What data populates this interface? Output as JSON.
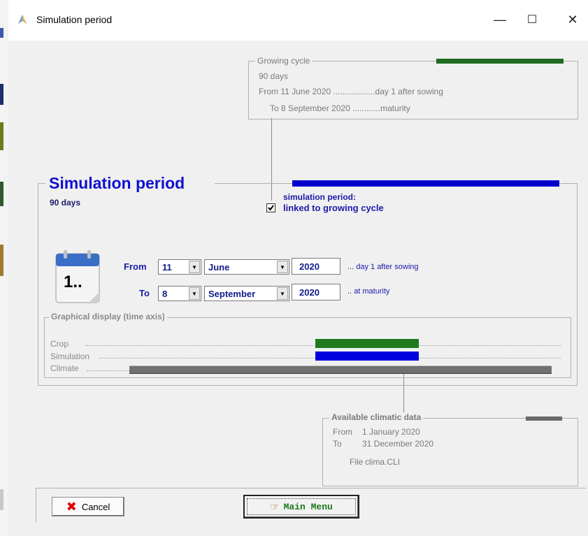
{
  "window": {
    "title": "Simulation period",
    "minimize": "—",
    "maximize": "☐",
    "close": "✕"
  },
  "growing_cycle": {
    "legend": "Growing cycle",
    "days": "90 days",
    "from_line": "From 11  June 2020 ..................day 1 after sowing",
    "to_line": "To 8  September 2020 ............maturity",
    "bar_color": "#1f6b1f"
  },
  "simulation": {
    "title": "Simulation period",
    "days": "90 days",
    "linked_label_1": "simulation period:",
    "linked_label_2": "linked to growing cycle",
    "linked_checked": true,
    "bar_color": "#0000cc",
    "calendar_text": "1..",
    "from_label": "From",
    "to_label": "To",
    "from_day": "11",
    "from_month": "June",
    "from_year": "2020",
    "from_note": "... day 1 after sowing",
    "to_day": "8",
    "to_month": "September",
    "to_year": "2020",
    "to_note": ".. at maturity"
  },
  "graphical": {
    "legend": "Graphical display (time axis)",
    "crop_label": "Crop",
    "simulation_label": "Simulation",
    "climate_label": "Climate",
    "crop_color": "#1f7a1f",
    "simulation_color": "#0000dd",
    "climate_color": "#707070"
  },
  "climate": {
    "legend": "Available climatic data",
    "from_label": "From",
    "from_value": "1 January 2020",
    "to_label": "To",
    "to_value": "31 December 2020",
    "file_label": "File",
    "file_value": "clima.CLI"
  },
  "buttons": {
    "cancel": "Cancel",
    "main_menu": "Main Menu"
  }
}
